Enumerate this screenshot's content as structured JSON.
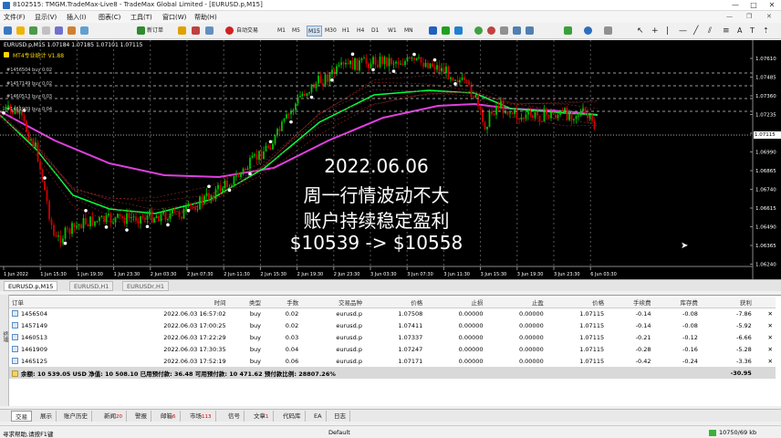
{
  "window": {
    "title": "8102515: TMGM.TradeMax-Live8 - TradeMax Global Limited - [EURUSD.p,M15]",
    "minimize": "—",
    "maximize": "□",
    "close": "✕"
  },
  "menu": [
    "文件(F)",
    "显示(V)",
    "插入(I)",
    "图表(C)",
    "工具(T)",
    "窗口(W)",
    "帮助(H)"
  ],
  "toolbar": {
    "new_order": "新订单",
    "auto_trading": "自动交易",
    "timeframes": [
      "M1",
      "M5",
      "M15",
      "M30",
      "H1",
      "H4",
      "D1",
      "W1",
      "MN"
    ]
  },
  "chart": {
    "header": "EURUSD.p,M15  1.07184 1.07185 1.07101 1.07115",
    "ea_label": "MT4专业统计 V1.88",
    "order_lines": [
      "#1456504 buy 0.02",
      "#1457149 buy 0.02",
      "#1460513 buy 0.03",
      "#1461909 buy 0.04"
    ],
    "price_ticks": [
      "1.07610",
      "1.07485",
      "1.07360",
      "1.07235",
      "1.07115",
      "1.06990",
      "1.06865",
      "1.06740",
      "1.06615",
      "1.06490",
      "1.06365",
      "1.06240"
    ],
    "current_price": "1.07115",
    "time_ticks": [
      "1 Jun 2022",
      "1 Jun 15:30",
      "1 Jun 19:30",
      "1 Jun 23:30",
      "2 Jun 03:30",
      "2 Jun 07:30",
      "2 Jun 11:30",
      "2 Jun 15:30",
      "2 Jun 19:30",
      "2 Jun 23:30",
      "3 Jun 03:30",
      "3 Jun 07:30",
      "3 Jun 11:30",
      "3 Jun 15:30",
      "3 Jun 19:30",
      "3 Jun 23:30",
      "6 Jun 03:30"
    ],
    "overlay": [
      "2022.06.06",
      "周一行情波动不大",
      "账户持续稳定盈利",
      "$10539 -> $10558"
    ]
  },
  "chart_tabs": [
    "EURUSD.p,M15",
    "EURUSD,H1",
    "EURUSDr,H1"
  ],
  "orders": {
    "headers": [
      "订单",
      "时间",
      "类型",
      "手数",
      "交易品种",
      "价格",
      "止损",
      "止盈",
      "价格",
      "手续费",
      "库存费",
      "获利"
    ],
    "rows": [
      [
        "1456504",
        "2022.06.03 16:57:02",
        "buy",
        "0.02",
        "eurusd.p",
        "1.07508",
        "0.00000",
        "0.00000",
        "1.07115",
        "-0.14",
        "-0.08",
        "-7.86"
      ],
      [
        "1457149",
        "2022.06.03 17:00:25",
        "buy",
        "0.02",
        "eurusd.p",
        "1.07411",
        "0.00000",
        "0.00000",
        "1.07115",
        "-0.14",
        "-0.08",
        "-5.92"
      ],
      [
        "1460513",
        "2022.06.03 17:22:29",
        "buy",
        "0.03",
        "eurusd.p",
        "1.07337",
        "0.00000",
        "0.00000",
        "1.07115",
        "-0.21",
        "-0.12",
        "-6.66"
      ],
      [
        "1461909",
        "2022.06.03 17:30:35",
        "buy",
        "0.04",
        "eurusd.p",
        "1.07247",
        "0.00000",
        "0.00000",
        "1.07115",
        "-0.28",
        "-0.16",
        "-5.28"
      ],
      [
        "1465125",
        "2022.06.03 17:52:19",
        "buy",
        "0.06",
        "eurusd.p",
        "1.07171",
        "0.00000",
        "0.00000",
        "1.07115",
        "-0.42",
        "-0.24",
        "-3.36"
      ]
    ],
    "summary": "余额: 10 539.05 USD  净值: 10 508.10  已用预付款: 36.48  可用预付款: 10 471.62  预付款比例: 28807.26%",
    "summary_profit": "-30.95"
  },
  "bottom_tabs": [
    {
      "label": "交易",
      "count": ""
    },
    {
      "label": "展示",
      "count": ""
    },
    {
      "label": "账户历史",
      "count": ""
    },
    {
      "label": "新闻",
      "count": "20"
    },
    {
      "label": "警报",
      "count": ""
    },
    {
      "label": "邮箱",
      "count": "6"
    },
    {
      "label": "市场",
      "count": "113"
    },
    {
      "label": "信号",
      "count": ""
    },
    {
      "label": "文章",
      "count": "1"
    },
    {
      "label": "代码库",
      "count": ""
    },
    {
      "label": "EA",
      "count": ""
    },
    {
      "label": "日志",
      "count": ""
    }
  ],
  "terminal_side": "终端",
  "status": {
    "help": "寻求帮助,请按F1键",
    "profile": "Default",
    "traffic": "10750/69 kb"
  },
  "colors": {
    "chart_bg": "#000000",
    "bull": "#00c000",
    "bear": "#d00000",
    "ma_magenta": "#e040e0",
    "ma_green": "#00ff40"
  }
}
